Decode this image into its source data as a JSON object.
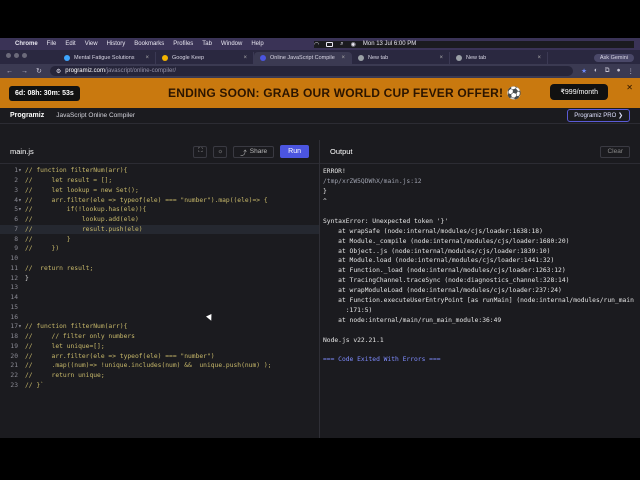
{
  "menubar": {
    "app": "Chrome",
    "items": [
      "File",
      "Edit",
      "View",
      "History",
      "Bookmarks",
      "Profiles",
      "Tab",
      "Window",
      "Help"
    ],
    "datetime": "Mon 13 Jul  6:00 PM"
  },
  "tabs": [
    {
      "title": "Mental Fatigue Solutions",
      "color": "#3ea6ff",
      "active": false
    },
    {
      "title": "Google Keep",
      "color": "#f4b400",
      "active": false
    },
    {
      "title": "Online JavaScript Compile",
      "color": "#4b55e0",
      "active": true
    },
    {
      "title": "New tab",
      "color": "#9aa0a6",
      "active": false
    },
    {
      "title": "New tab",
      "color": "#9aa0a6",
      "active": false
    }
  ],
  "ask_gemini": "Ask Gemini",
  "address": {
    "host": "programiz.com",
    "path": "/javascript/online-compiler/"
  },
  "promo": {
    "timer": "6d: 08h: 30m: 53s",
    "text": "ENDING SOON: GRAB OUR WORLD CUP FEVER OFFER! ⚽",
    "price": "₹999/month",
    "close": "✕"
  },
  "site": {
    "logo": "Programiz",
    "subtitle": "JavaScript Online Compiler",
    "pro": "Programiz PRO ❯"
  },
  "editor": {
    "filename": "main.js",
    "share": "Share",
    "run": "Run",
    "lines": [
      {
        "n": "1",
        "f": "▾",
        "t": "// function filterNum(arr){"
      },
      {
        "n": "2",
        "f": "",
        "t": "//     let result = [];"
      },
      {
        "n": "3",
        "f": "",
        "t": "//     let lookup = new Set();"
      },
      {
        "n": "4",
        "f": "▾",
        "t": "//     arr.filter(ele => typeof(ele) === \"number\").map((ele)=> {"
      },
      {
        "n": "5",
        "f": "▾",
        "t": "//         if(!lookup.has(ele)){"
      },
      {
        "n": "6",
        "f": "",
        "t": "//             lookup.add(ele)"
      },
      {
        "n": "7",
        "f": "",
        "t": "//             result.push(ele)"
      },
      {
        "n": "8",
        "f": "",
        "t": "//         }"
      },
      {
        "n": "9",
        "f": "",
        "t": "//     })"
      },
      {
        "n": "10",
        "f": "",
        "t": ""
      },
      {
        "n": "11",
        "f": "",
        "t": "//  return result;"
      },
      {
        "n": "12",
        "f": "",
        "t": "}"
      },
      {
        "n": "13",
        "f": "",
        "t": ""
      },
      {
        "n": "14",
        "f": "",
        "t": ""
      },
      {
        "n": "15",
        "f": "",
        "t": ""
      },
      {
        "n": "16",
        "f": "",
        "t": ""
      },
      {
        "n": "17",
        "f": "▾",
        "t": "// function filterNum(arr){"
      },
      {
        "n": "18",
        "f": "",
        "t": "//     // filter only numbers"
      },
      {
        "n": "19",
        "f": "",
        "t": "//     let unique=[];"
      },
      {
        "n": "20",
        "f": "",
        "t": "//     arr.filter(ele => typeof(ele) === \"number\")"
      },
      {
        "n": "21",
        "f": "",
        "t": "//     .map((num)=> !unique.includes(num) &&  unique.push(num) );"
      },
      {
        "n": "22",
        "f": "",
        "t": "//     return unique;"
      },
      {
        "n": "23",
        "f": "",
        "t": "// }`"
      }
    ]
  },
  "output": {
    "title": "Output",
    "clear": "Clear",
    "lines": [
      {
        "t": "ERROR!",
        "k": ""
      },
      {
        "t": "/tmp/xrZW5QDWhX/main.js:12",
        "k": "dim"
      },
      {
        "t": "}",
        "k": ""
      },
      {
        "t": "^",
        "k": ""
      },
      {
        "t": "",
        "k": ""
      },
      {
        "t": "SyntaxError: Unexpected token '}'",
        "k": ""
      },
      {
        "t": "    at wrapSafe (node:internal/modules/cjs/loader:1638:18)",
        "k": ""
      },
      {
        "t": "    at Module._compile (node:internal/modules/cjs/loader:1680:20)",
        "k": ""
      },
      {
        "t": "    at Object..js (node:internal/modules/cjs/loader:1839:10)",
        "k": ""
      },
      {
        "t": "    at Module.load (node:internal/modules/cjs/loader:1441:32)",
        "k": ""
      },
      {
        "t": "    at Function._load (node:internal/modules/cjs/loader:1263:12)",
        "k": ""
      },
      {
        "t": "    at TracingChannel.traceSync (node:diagnostics_channel:328:14)",
        "k": ""
      },
      {
        "t": "    at wrapModuleLoad (node:internal/modules/cjs/loader:237:24)",
        "k": ""
      },
      {
        "t": "    at Function.executeUserEntryPoint [as runMain] (node:internal/modules/run_main",
        "k": ""
      },
      {
        "t": "      :171:5)",
        "k": ""
      },
      {
        "t": "    at node:internal/main/run_main_module:36:49",
        "k": ""
      },
      {
        "t": "",
        "k": ""
      },
      {
        "t": "Node.js v22.21.1",
        "k": ""
      },
      {
        "t": "",
        "k": ""
      },
      {
        "t": "=== Code Exited With Errors ===",
        "k": "exit"
      }
    ]
  }
}
